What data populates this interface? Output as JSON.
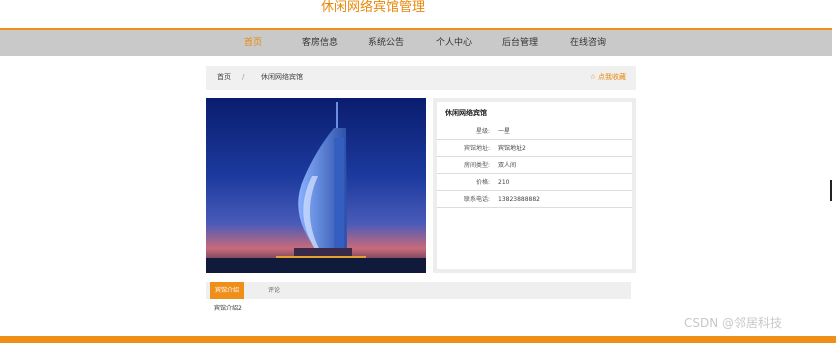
{
  "header": {
    "site_title": "休闲网络宾馆管理"
  },
  "nav": {
    "items": [
      {
        "label": "首页",
        "active": true
      },
      {
        "label": "客房信息",
        "active": false
      },
      {
        "label": "系统公告",
        "active": false
      },
      {
        "label": "个人中心",
        "active": false
      },
      {
        "label": "后台管理",
        "active": false
      },
      {
        "label": "在线咨询",
        "active": false
      }
    ]
  },
  "breadcrumb": {
    "home": "首页",
    "separator": "/",
    "current": "休闲网络宾馆"
  },
  "favorite": {
    "label": "点我收藏",
    "icon": "star-icon"
  },
  "hero": {
    "alt_icon": "hotel-photo"
  },
  "info": {
    "title": "休闲网络宾馆",
    "rows": [
      {
        "label": "星级:",
        "value": "一星"
      },
      {
        "label": "宾馆地址:",
        "value": "宾馆地址2"
      },
      {
        "label": "房间类型:",
        "value": "双人间"
      },
      {
        "label": "价格:",
        "value": "210"
      },
      {
        "label": "联系电话:",
        "value": "13823888882"
      }
    ]
  },
  "tabs": {
    "items": [
      {
        "label": "宾馆介绍",
        "active": true
      },
      {
        "label": "评论",
        "active": false
      }
    ],
    "content": "宾馆介绍2"
  },
  "watermark": "CSDN @邻居科技",
  "colors": {
    "accent": "#ef8f1a",
    "nav_bg": "#c9c9c9",
    "panel_bg": "#f0f0f0"
  }
}
